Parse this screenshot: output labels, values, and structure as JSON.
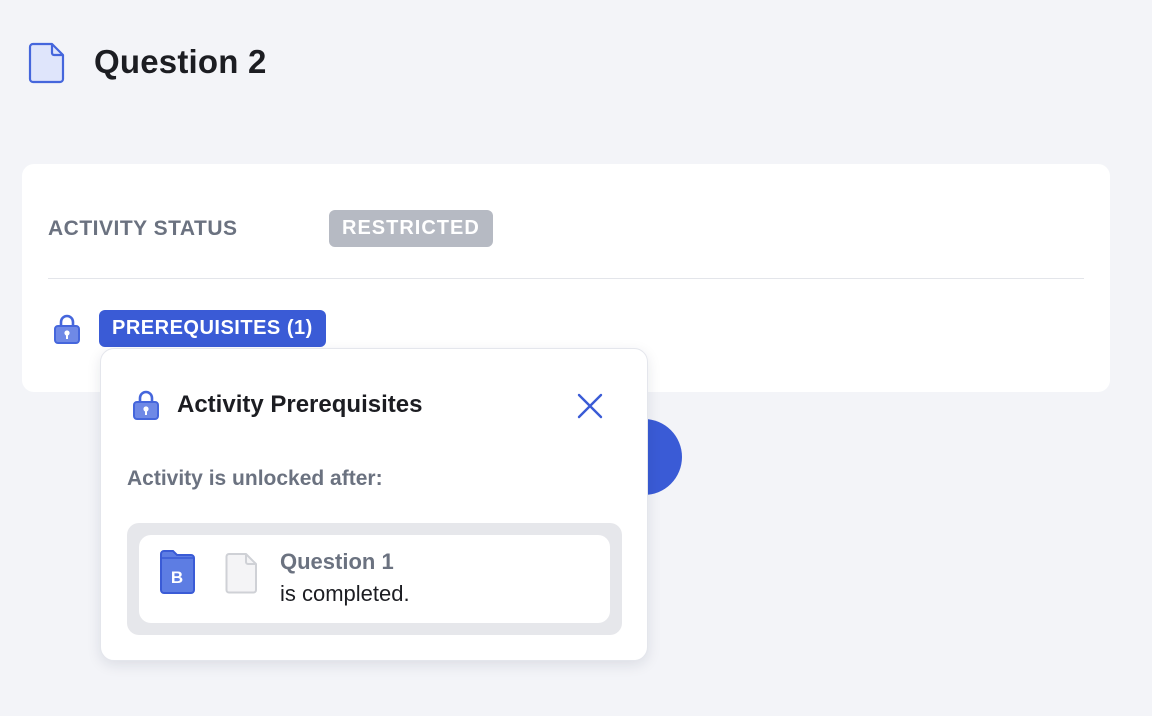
{
  "header": {
    "title": "Question 2",
    "icon": "document-icon"
  },
  "card": {
    "status_label": "ACTIVITY STATUS",
    "status_badge": "RESTRICTED",
    "prereq_icon": "lock-icon",
    "prereq_button": "PREREQUISITES (1)"
  },
  "popover": {
    "icon": "lock-icon",
    "title": "Activity Prerequisites",
    "close_icon": "close-icon",
    "unlock_text": "Activity is unlocked after:",
    "requirement": {
      "book_icon": "book-icon",
      "book_letter": "B",
      "doc_icon": "document-icon",
      "title": "Question 1",
      "subtitle": "is completed."
    }
  },
  "colors": {
    "accent": "#3a5bd6",
    "badge_gray": "#b6bac3",
    "muted_text": "#6b7280",
    "background": "#f3f4f8"
  }
}
